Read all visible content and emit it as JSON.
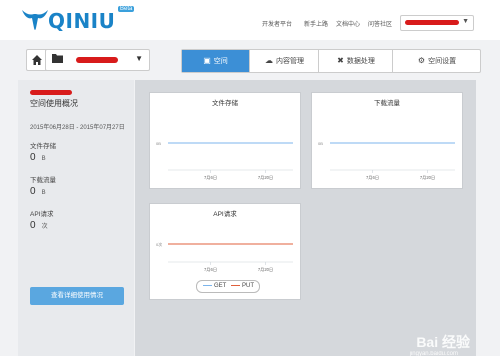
{
  "header": {
    "logo_text": "QINIU",
    "logo_badge": "Beta",
    "nav": [
      "开发者平台",
      "新手上路",
      "文档中心",
      "问答社区"
    ]
  },
  "toolbar": {
    "tabs": [
      {
        "label": "空间",
        "icon": "box-icon"
      },
      {
        "label": "内容管理",
        "icon": "cloud-icon"
      },
      {
        "label": "数据处理",
        "icon": "tools-icon"
      },
      {
        "label": "空间设置",
        "icon": "gear-icon"
      }
    ]
  },
  "sidebar": {
    "title": "空间使用概况",
    "date_range": "2015年06月28日 - 2015年07月27日",
    "stats": [
      {
        "label": "文件存储",
        "value": "0",
        "unit": "B"
      },
      {
        "label": "下载流量",
        "value": "0",
        "unit": "B"
      },
      {
        "label": "API请求",
        "value": "0",
        "unit": "次"
      }
    ],
    "button": "查看详细使用情况"
  },
  "chart_data": [
    {
      "type": "line",
      "title": "文件存储",
      "x": [
        "7月6日",
        "7月20日"
      ],
      "series": [
        {
          "values": [
            0,
            0
          ],
          "color": "#7cb5ec"
        }
      ],
      "ytick": "0B"
    },
    {
      "type": "line",
      "title": "下载流量",
      "x": [
        "7月6日",
        "7月20日"
      ],
      "series": [
        {
          "values": [
            0,
            0
          ],
          "color": "#7cb5ec"
        }
      ],
      "ytick": "0B"
    },
    {
      "type": "line",
      "title": "API请求",
      "x": [
        "7月6日",
        "7月20日"
      ],
      "series": [
        {
          "name": "GET",
          "values": [
            0,
            0
          ],
          "color": "#7cb5ec"
        },
        {
          "name": "PUT",
          "values": [
            0,
            0
          ],
          "color": "#e0603c"
        }
      ],
      "ytick": "0次"
    }
  ],
  "watermark": {
    "main": "Bai 经验",
    "sub": "jingyan.baidu.com"
  }
}
